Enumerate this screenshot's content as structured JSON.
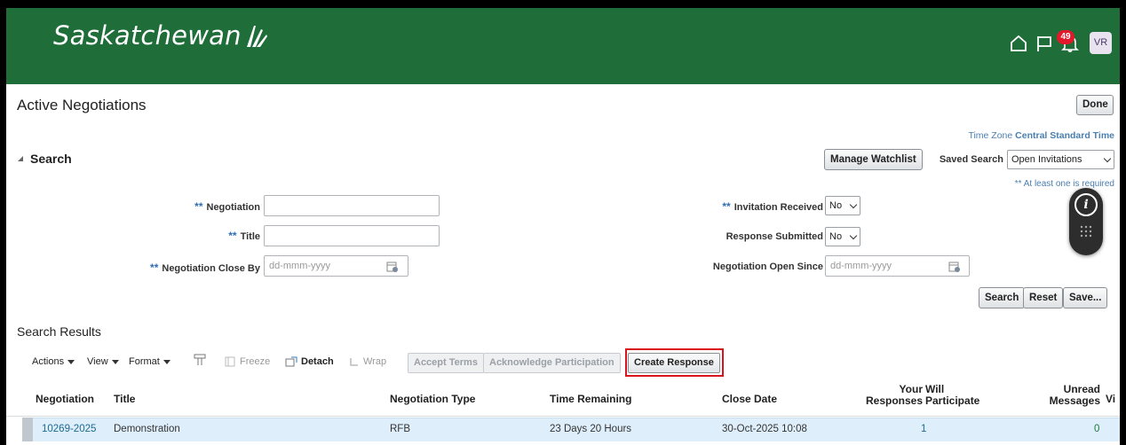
{
  "header": {
    "brand": "Saskatchewan",
    "notifications_count": "49",
    "user_initials": "VR",
    "icons": [
      "home-icon",
      "flag-icon",
      "bell-icon"
    ]
  },
  "page": {
    "title": "Active Negotiations",
    "done_label": "Done",
    "timezone_prefix": "Time Zone ",
    "timezone_value": "Central Standard Time"
  },
  "search": {
    "title": "Search",
    "manage_watchlist": "Manage Watchlist",
    "saved_search_label": "Saved Search",
    "saved_search_value": "Open Invitations",
    "at_least_one": "** At least one is required",
    "required_marker": "**",
    "fields": {
      "negotiation_label": "Negotiation",
      "negotiation_value": "",
      "title_label": "Title",
      "title_value": "",
      "close_by_label": "Negotiation Close By",
      "close_by_placeholder": "dd-mmm-yyyy",
      "invitation_received_label": "Invitation Received",
      "invitation_received_value": "No",
      "response_submitted_label": "Response Submitted",
      "response_submitted_value": "No",
      "open_since_label": "Negotiation Open Since",
      "open_since_placeholder": "dd-mmm-yyyy"
    },
    "buttons": {
      "search": "Search",
      "reset": "Reset",
      "save": "Save..."
    }
  },
  "results": {
    "title": "Search Results",
    "toolbar": {
      "actions": "Actions",
      "view": "View",
      "format": "Format",
      "freeze": "Freeze",
      "detach": "Detach",
      "wrap": "Wrap",
      "accept_terms": "Accept Terms",
      "acknowledge": "Acknowledge Participation",
      "create_response": "Create Response"
    },
    "columns": {
      "negotiation": "Negotiation",
      "title": "Title",
      "type": "Negotiation Type",
      "time_remaining": "Time Remaining",
      "close_date": "Close Date",
      "your_responses_1": "Your",
      "your_responses_2": "Responses",
      "will_participate_1": "Will",
      "will_participate_2": "Participate",
      "unread_1": "Unread",
      "unread_2": "Messages",
      "view_cut": "Vi"
    },
    "rows": [
      {
        "negotiation": "10269-2025",
        "title": "Demonstration",
        "type": "RFB",
        "time_remaining": "23 Days 20 Hours",
        "close_date": "30-Oct-2025 10:08",
        "your_responses": "1",
        "will_participate": "",
        "unread_messages": "0"
      }
    ]
  },
  "colors": {
    "header_green": "#1f6d39",
    "highlight_red": "#d9141c",
    "row_blue": "#dfeefb"
  }
}
